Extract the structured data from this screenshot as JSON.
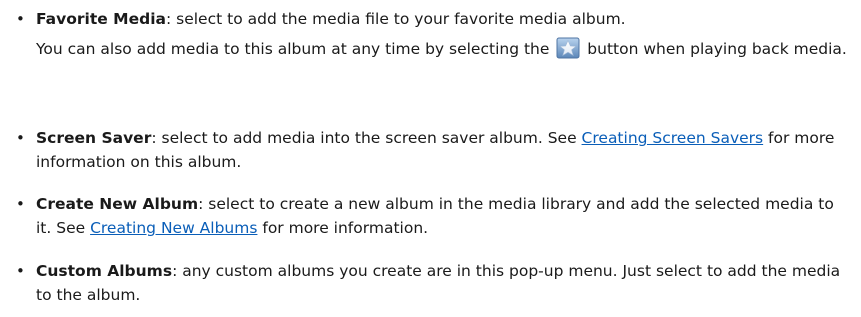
{
  "items": [
    {
      "term": "Favorite Media",
      "text": ": select to add the media file to your favorite media album."
    },
    {
      "term": "Screen Saver",
      "text_before": ": select to add media into the screen saver album. See ",
      "link": "Creating Screen Savers",
      "text_after": " for more information on this album."
    },
    {
      "term": "Create New Album",
      "text_before": ": select to create a new album in the media library and add the selected media to it. See ",
      "link": "Creating New Albums",
      "text_after": " for more information."
    },
    {
      "term": "Custom Albums",
      "text": ": any custom albums you create are in this pop-up menu. Just select to add the media to the album."
    }
  ],
  "favorite_note": {
    "before": "You can also add media to this album at any time by selecting the",
    "icon": "favorite-star-icon",
    "after": "button when playing back media."
  },
  "bullet_char": "•",
  "colors": {
    "text": "#1a1a1a",
    "link": "#0a5eb8"
  }
}
